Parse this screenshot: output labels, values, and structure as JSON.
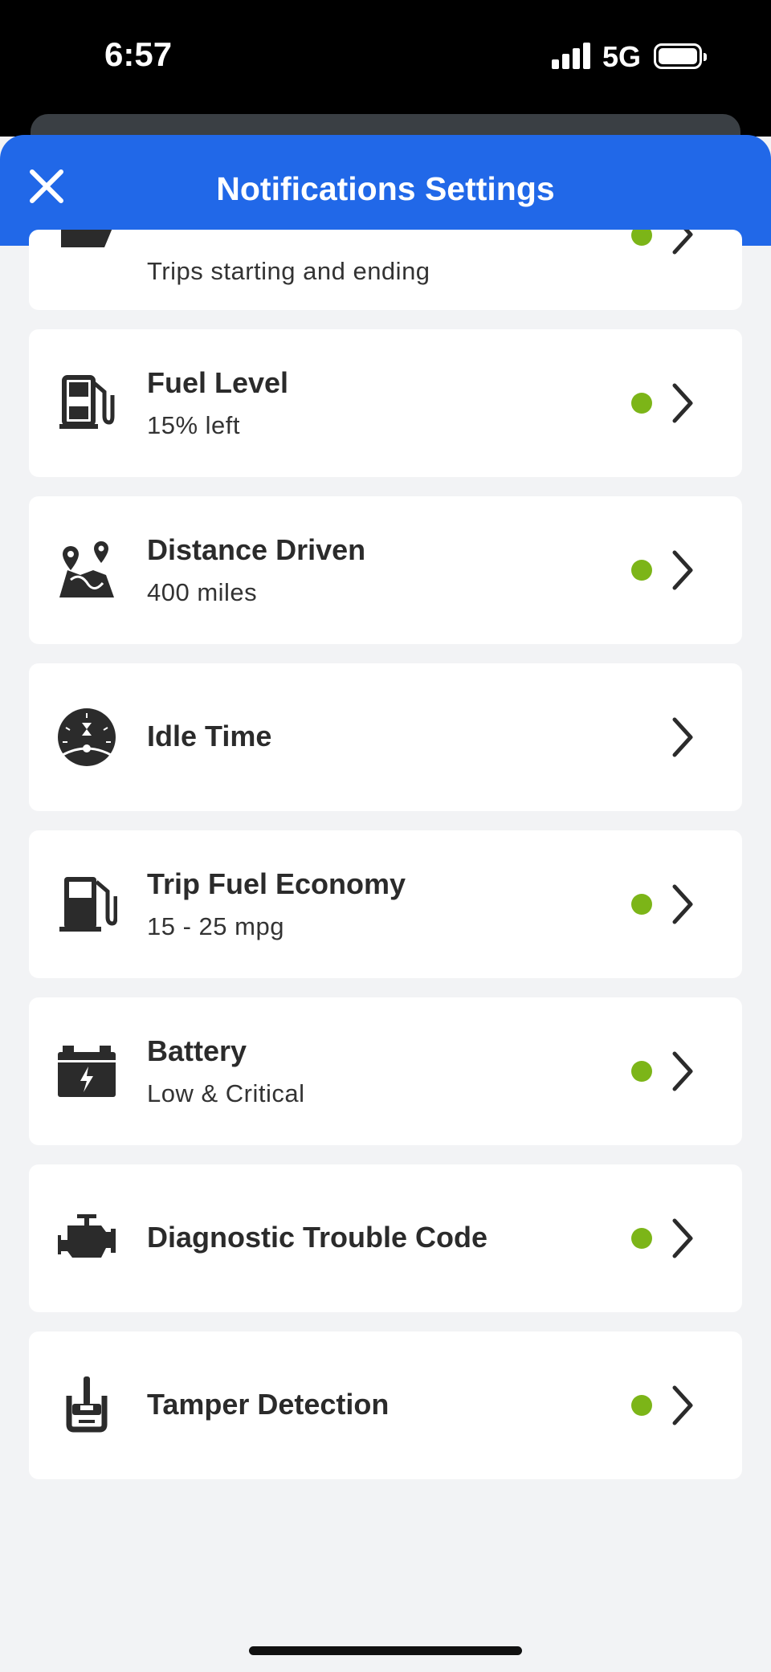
{
  "status_bar": {
    "time": "6:57",
    "network": "5G"
  },
  "header": {
    "title": "Notifications Settings"
  },
  "colors": {
    "header_blue": "#2168e8",
    "enabled_dot": "#7cb518",
    "background": "#f2f3f5"
  },
  "items": [
    {
      "title": "",
      "subtitle": "Trips starting and ending",
      "icon": "trip-car-icon",
      "enabled": true
    },
    {
      "title": "Fuel Level",
      "subtitle": "15% left",
      "icon": "fuel-pump-icon",
      "enabled": true
    },
    {
      "title": "Distance Driven",
      "subtitle": "400 miles",
      "icon": "map-route-icon",
      "enabled": true
    },
    {
      "title": "Idle Time",
      "subtitle": "",
      "icon": "idle-gauge-icon",
      "enabled": false
    },
    {
      "title": "Trip Fuel Economy",
      "subtitle": "15 - 25 mpg",
      "icon": "fuel-economy-icon",
      "enabled": true
    },
    {
      "title": "Battery",
      "subtitle": "Low & Critical",
      "icon": "battery-icon",
      "enabled": true
    },
    {
      "title": "Diagnostic Trouble Code",
      "subtitle": "",
      "icon": "engine-icon",
      "enabled": true
    },
    {
      "title": "Tamper Detection",
      "subtitle": "",
      "icon": "tamper-icon",
      "enabled": true
    }
  ]
}
